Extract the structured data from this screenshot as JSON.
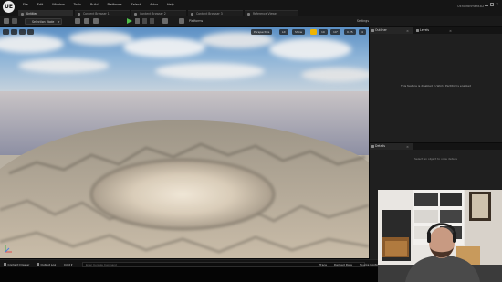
{
  "app": {
    "logo_text": "UE"
  },
  "menu": [
    "File",
    "Edit",
    "Window",
    "Tools",
    "Build",
    "Platforms",
    "Select",
    "Actor",
    "Help"
  ],
  "doc_tabs": [
    {
      "label": "Untitled",
      "active": true
    },
    {
      "label": "Content Browser 1",
      "active": false
    },
    {
      "label": "Content Browser 2",
      "active": false
    },
    {
      "label": "Content Browser 3",
      "active": false
    },
    {
      "label": "Reference Viewer",
      "active": false
    }
  ],
  "project_name": "UEnvironment3D",
  "toolbar": {
    "mode_label": "Selection Mode",
    "platforms_label": "Platforms",
    "settings_label": "Settings"
  },
  "viewport": {
    "perspective_label": "Perspective",
    "lit_label": "Lit",
    "show_label": "Show",
    "grid_value": "10",
    "angle_value": "10°",
    "scale_value": "0.25",
    "camera_speed": "4"
  },
  "outliner": {
    "tab_label": "Outliner",
    "second_tab_label": "Levels",
    "message": "This feature is disabled in World Partition's enabled"
  },
  "details": {
    "tab_label": "Details",
    "message": "Select an object to view details"
  },
  "statusbar": {
    "content_drawer": "Content Drawer",
    "output_log": "Output Log",
    "cmd_label": "Cmd",
    "cmd_placeholder": "Enter Console Command",
    "trace": "Trace",
    "derived_data": "Derived Data",
    "source_control": "Source Control"
  },
  "colors": {
    "accent": "#f0b400",
    "play": "#4fbf4a",
    "panel_bg": "#1f1f1f"
  }
}
